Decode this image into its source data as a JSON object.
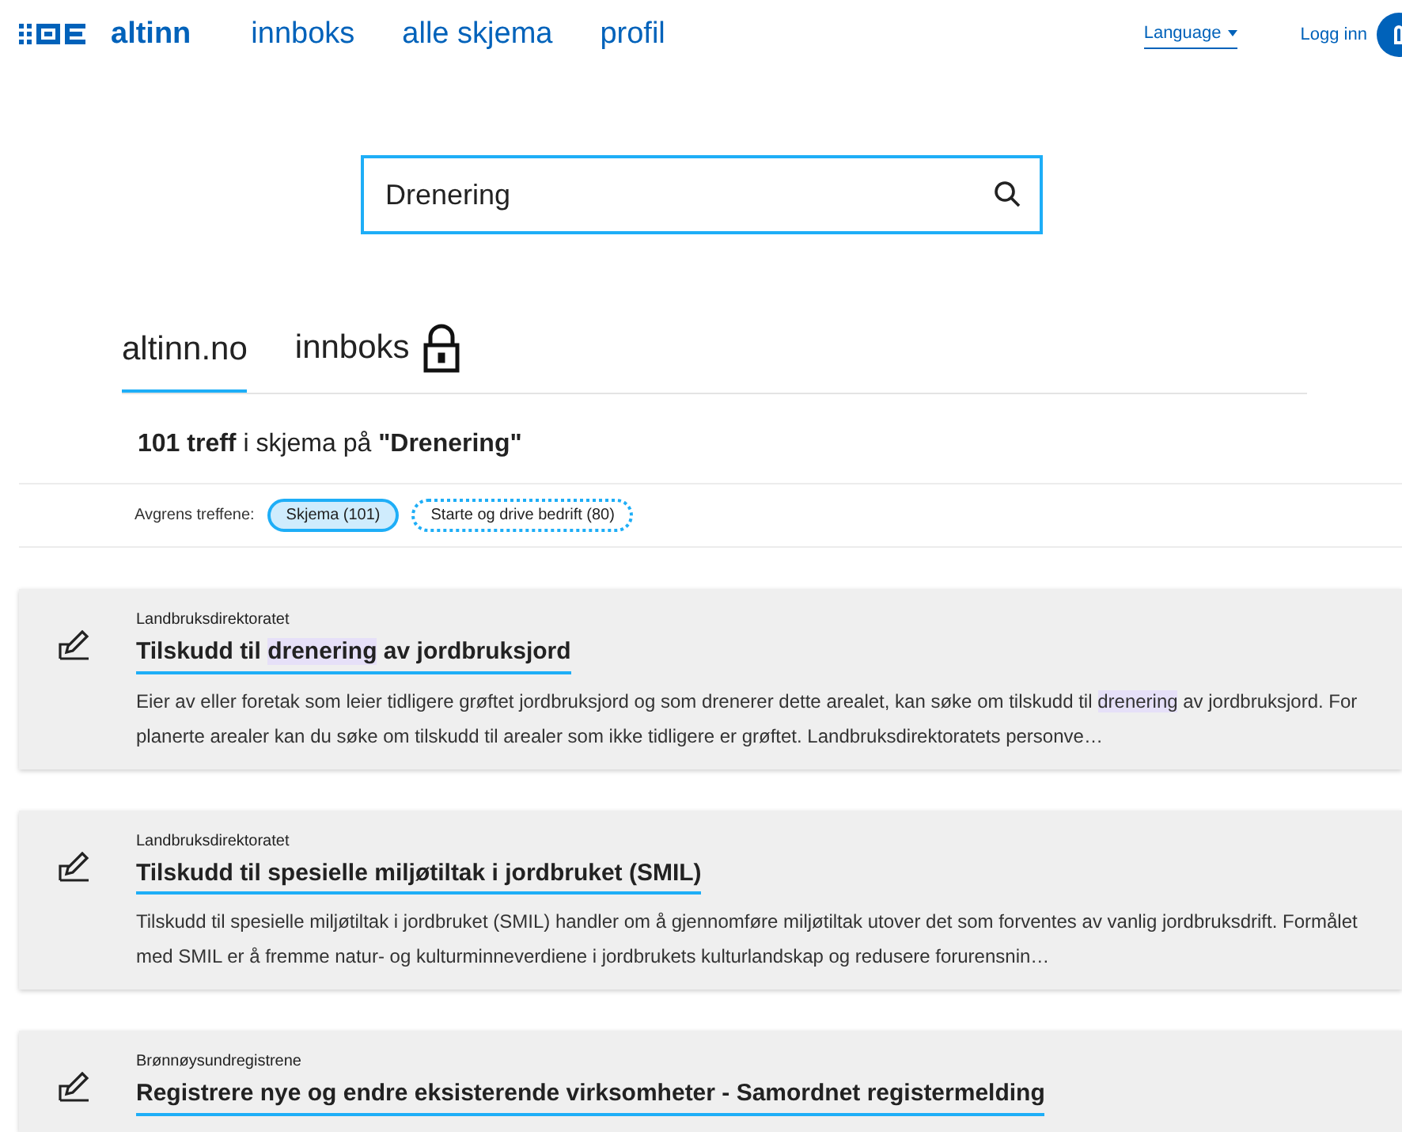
{
  "header": {
    "logo": "altinn",
    "nav": [
      "innboks",
      "alle skjema",
      "profil"
    ],
    "language": "Language",
    "login": "Logg inn"
  },
  "search": {
    "value": "Drenering"
  },
  "tabs": [
    {
      "label": "altinn.no",
      "selected": true,
      "locked": false
    },
    {
      "label": "innboks",
      "selected": false,
      "locked": true
    }
  ],
  "summary": {
    "text": "**101 treff** i skjema på **\"Drenering\"**"
  },
  "filters": {
    "label": "Avgrens treffene:",
    "chips": [
      {
        "label": "Skjema (101)",
        "selected": true
      },
      {
        "label": "Starte og drive bedrift (80)",
        "selected": false
      }
    ]
  },
  "results": [
    {
      "source": "Landbruksdirektoratet",
      "title": [
        {
          "text": "Tilskudd til ",
          "highlight": false
        },
        {
          "text": "drenering",
          "highlight": true
        },
        {
          "text": " av jordbruksjord",
          "highlight": false
        }
      ],
      "description": [
        {
          "text": "Eier av eller foretak som leier tidligere grøftet jordbruksjord og som drenerer dette arealet, kan søke om tilskudd til ",
          "highlight": false
        },
        {
          "text": "drenering",
          "highlight": true
        },
        {
          "text": " av jordbruksjord. For planerte arealer kan du søke om tilskudd til arealer som ikke tidligere er grøftet. Landbruksdirektoratets personve…",
          "highlight": false
        }
      ]
    },
    {
      "source": "Landbruksdirektoratet",
      "title": [
        {
          "text": "Tilskudd til spesielle miljøtiltak i jordbruket (SMIL)",
          "highlight": false
        }
      ],
      "description": [
        {
          "text": "Tilskudd til spesielle miljøtiltak i jordbruket (SMIL) handler om å gjennomføre miljøtiltak utover det som forventes av vanlig jordbruksdrift. Formålet med SMIL er å fremme natur- og kulturminneverdiene i jordbrukets kulturlandskap og redusere forurensnin…",
          "highlight": false
        }
      ]
    },
    {
      "source": "Brønnøysundregistrene",
      "title": [
        {
          "text": "Registrere nye og endre eksisterende virksomheter - Samordnet registermelding",
          "highlight": false
        }
      ]
    }
  ]
}
